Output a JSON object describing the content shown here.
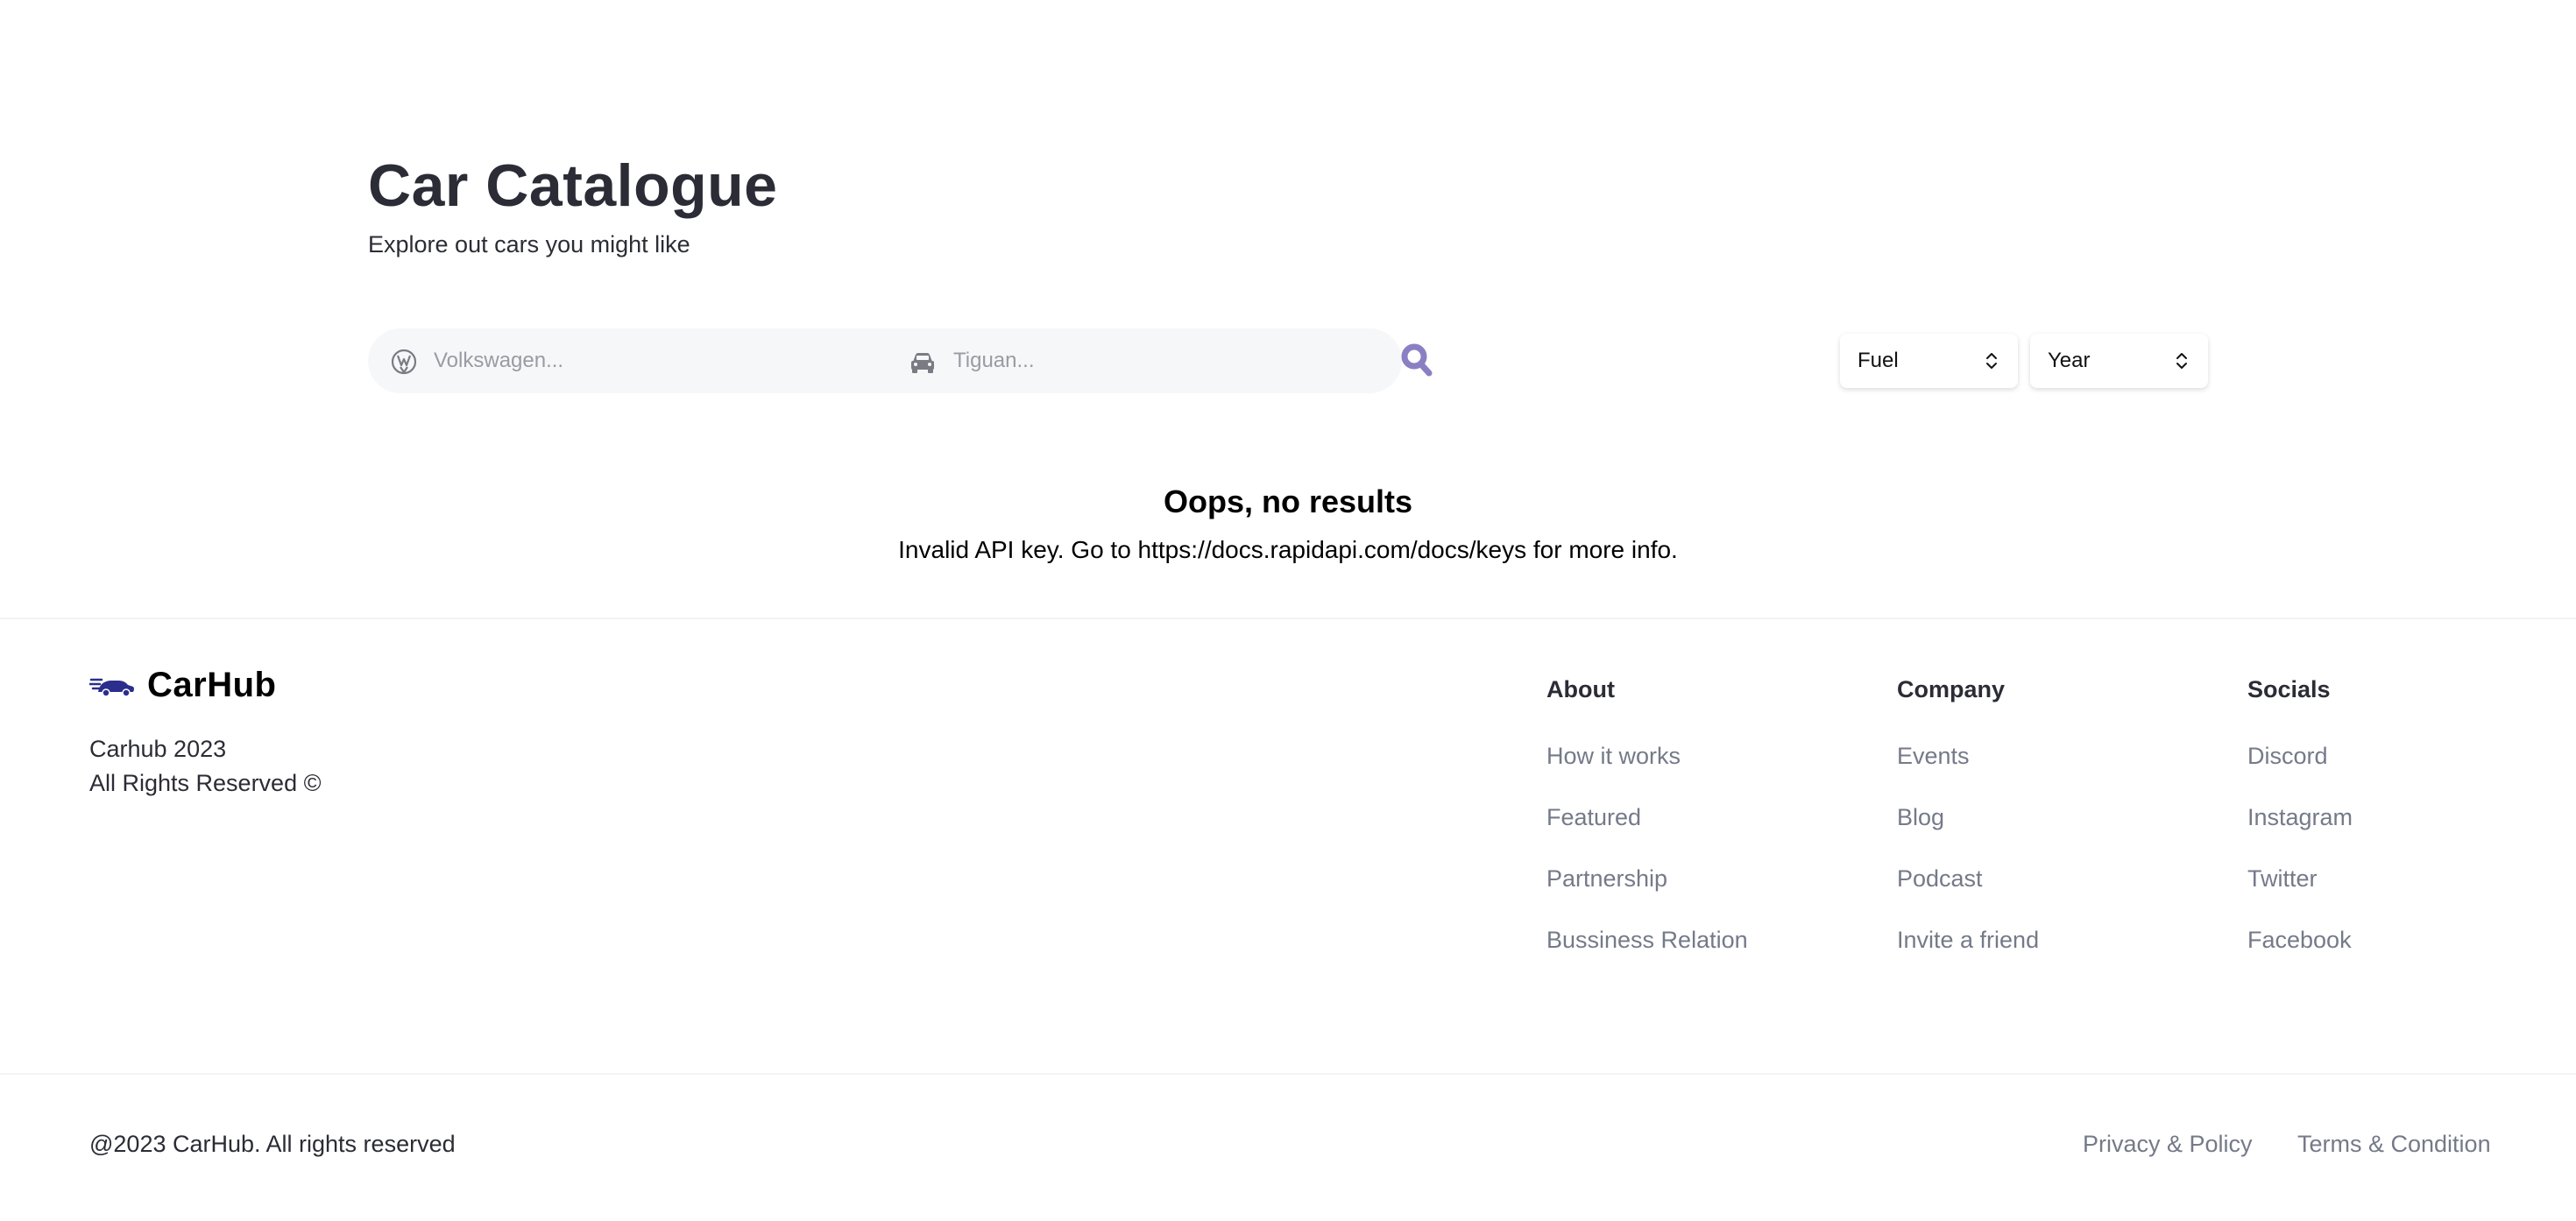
{
  "hero": {
    "title": "Car Catalogue",
    "subtitle": "Explore out cars you might like"
  },
  "search": {
    "make_placeholder": "Volkswagen...",
    "model_placeholder": "Tiguan...",
    "make_icon": "volkswagen-logo-icon",
    "model_icon": "car-icon",
    "submit_icon": "magnifying-glass-icon",
    "accent_color": "#8b7fc4"
  },
  "filters": [
    {
      "label": "Fuel"
    },
    {
      "label": "Year"
    }
  ],
  "empty_state": {
    "title": "Oops, no results",
    "message": "Invalid API key. Go to https://docs.rapidapi.com/docs/keys for more info."
  },
  "footer": {
    "brand": "CarHub",
    "brand_color": "#2b2e8c",
    "copy_line_1": "Carhub 2023",
    "copy_line_2": "All Rights Reserved ©",
    "columns": [
      {
        "title": "About",
        "links": [
          "How it works",
          "Featured",
          "Partnership",
          "Bussiness Relation"
        ]
      },
      {
        "title": "Company",
        "links": [
          "Events",
          "Blog",
          "Podcast",
          "Invite a friend"
        ]
      },
      {
        "title": "Socials",
        "links": [
          "Discord",
          "Instagram",
          "Twitter",
          "Facebook"
        ]
      }
    ],
    "bottom_text": "@2023 CarHub. All rights reserved",
    "bottom_links": [
      "Privacy & Policy",
      "Terms & Condition"
    ]
  }
}
